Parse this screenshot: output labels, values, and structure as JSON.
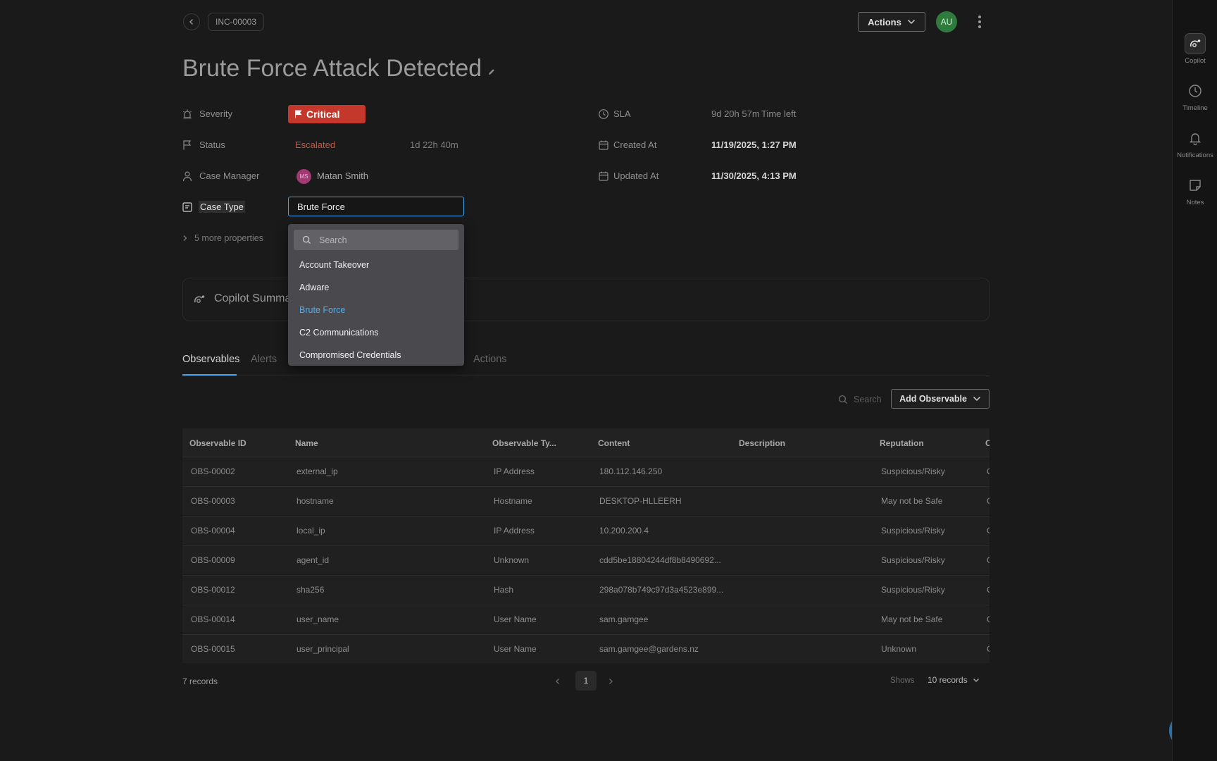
{
  "header": {
    "incident_id": "INC-00003",
    "actions_label": "Actions",
    "user_initials": "AU"
  },
  "page_title": "Brute Force Attack Detected",
  "properties": {
    "severity": {
      "label": "Severity",
      "value": "Critical"
    },
    "status": {
      "label": "Status",
      "value": "Escalated",
      "duration": "1d 22h 40m"
    },
    "case_manager": {
      "label": "Case Manager",
      "initials": "MS",
      "value": "Matan Smith"
    },
    "case_type": {
      "label": "Case Type",
      "value": "Brute Force"
    },
    "sla": {
      "label": "SLA",
      "value": "9d 20h 57m",
      "suffix": "Time left"
    },
    "created_at": {
      "label": "Created At",
      "value": "11/19/2025, 1:27 PM"
    },
    "updated_at": {
      "label": "Updated At",
      "value": "11/30/2025, 4:13 PM"
    },
    "more": "5 more properties"
  },
  "dropdown": {
    "search_placeholder": "Search",
    "options": [
      "Account Takeover",
      "Adware",
      "Brute Force",
      "C2 Communications",
      "Compromised Credentials"
    ],
    "selected": "Brute Force"
  },
  "copilot_card_title": "Copilot Summa",
  "tabs": [
    "Observables",
    "Alerts",
    "Actions"
  ],
  "observables": {
    "search_placeholder": "Search",
    "add_label": "Add Observable",
    "columns": [
      "Observable ID",
      "Name",
      "Observable Ty...",
      "Content",
      "Description",
      "Reputation",
      "C"
    ],
    "rows": [
      [
        "OBS-00002",
        "external_ip",
        "IP Address",
        "180.112.146.250",
        "",
        "Suspicious/Risky",
        "C"
      ],
      [
        "OBS-00003",
        "hostname",
        "Hostname",
        "DESKTOP-HLLEERH",
        "",
        "May not be Safe",
        "C"
      ],
      [
        "OBS-00004",
        "local_ip",
        "IP Address",
        "10.200.200.4",
        "",
        "Suspicious/Risky",
        "C"
      ],
      [
        "OBS-00009",
        "agent_id",
        "Unknown",
        "cdd5be18804244df8b8490692...",
        "",
        "Suspicious/Risky",
        "C"
      ],
      [
        "OBS-00012",
        "sha256",
        "Hash",
        "298a078b749c97d3a4523e899...",
        "",
        "Suspicious/Risky",
        "C"
      ],
      [
        "OBS-00014",
        "user_name",
        "User Name",
        "sam.gamgee",
        "",
        "May not be Safe",
        "C"
      ],
      [
        "OBS-00015",
        "user_principal",
        "User Name",
        "sam.gamgee@gardens.nz",
        "",
        "Unknown",
        "C"
      ]
    ]
  },
  "pagination": {
    "records": "7 records",
    "page": "1",
    "shows_label": "Shows",
    "page_size": "10 records"
  },
  "right_rail": [
    "Copilot",
    "Timeline",
    "Notifications",
    "Notes"
  ],
  "colors": {
    "accent": "#3fa6ef",
    "critical": "#c4372b",
    "status_escalated": "#c8553d",
    "background": "#1a1a1a"
  },
  "icons": [
    "chevron-left-icon",
    "chevron-down-icon",
    "kebab-icon",
    "pencil-icon",
    "alarm-icon",
    "flag-icon",
    "user-icon",
    "case-type-icon",
    "clock-icon",
    "calendar-icon",
    "search-icon",
    "copilot-icon",
    "bell-icon",
    "note-icon",
    "chat-icon"
  ]
}
